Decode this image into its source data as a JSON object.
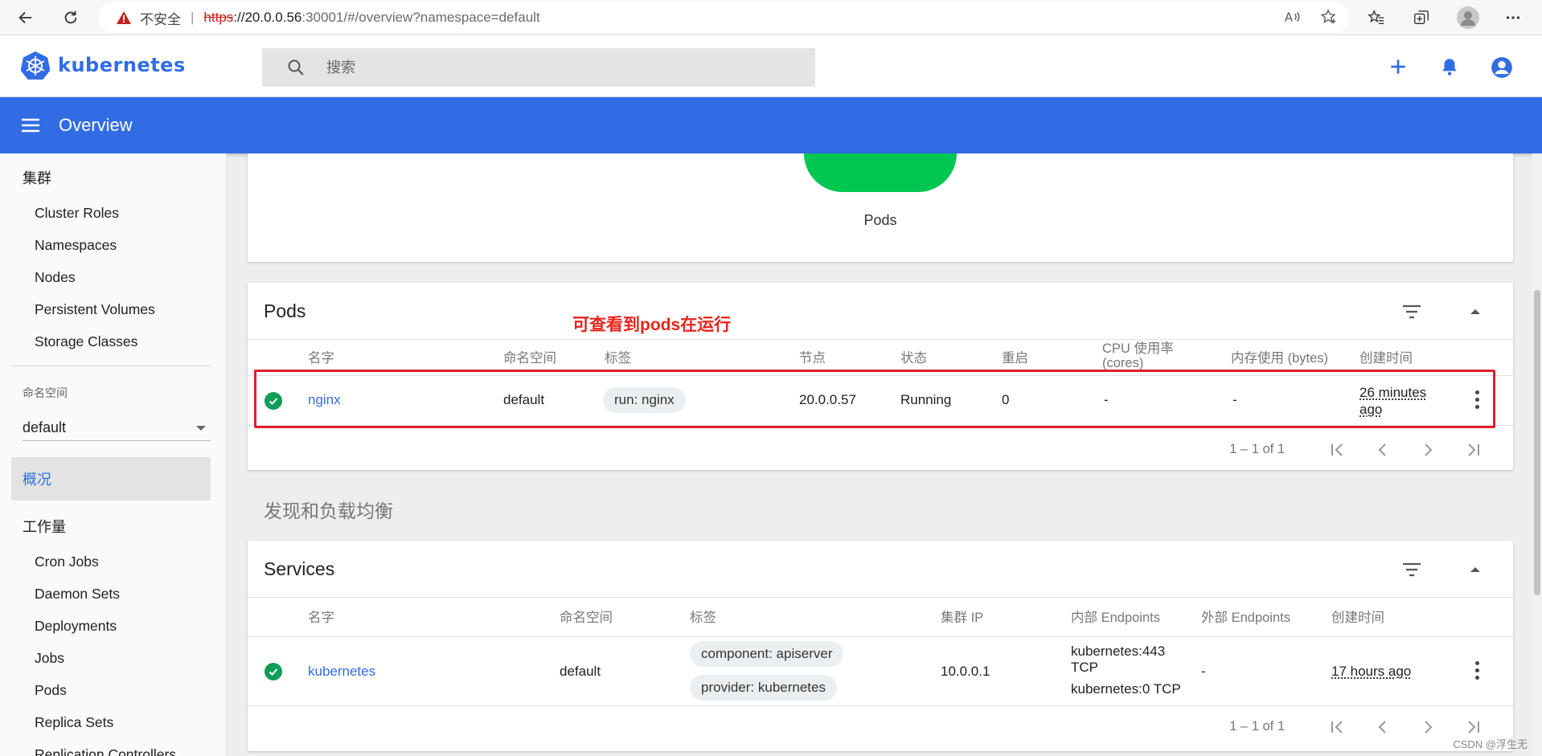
{
  "browser": {
    "insecure_label": "不安全",
    "url_scheme": "https",
    "url_host": "://20.0.0.56",
    "url_rest": ":30001/#/overview?namespace=default"
  },
  "app": {
    "logo_text": "kubernetes",
    "search_placeholder": "搜索",
    "toolbar_title": "Overview"
  },
  "sidebar": {
    "cluster_heading": "集群",
    "cluster_items": [
      "Cluster Roles",
      "Namespaces",
      "Nodes",
      "Persistent Volumes",
      "Storage Classes"
    ],
    "namespace_label": "命名空间",
    "namespace_value": "default",
    "overview_label": "概况",
    "workloads_heading": "工作量",
    "workload_items": [
      "Cron Jobs",
      "Daemon Sets",
      "Deployments",
      "Jobs",
      "Pods",
      "Replica Sets",
      "Replication Controllers"
    ]
  },
  "chart_card": {
    "label": "Pods"
  },
  "pods": {
    "title": "Pods",
    "annotation": "可查看到pods在运行",
    "columns": [
      "名字",
      "命名空间",
      "标签",
      "节点",
      "状态",
      "重启",
      "CPU 使用率 (cores)",
      "内存使用 (bytes)",
      "创建时间"
    ],
    "rows": [
      {
        "name": "nginx",
        "namespace": "default",
        "label": "run: nginx",
        "node": "20.0.0.57",
        "status": "Running",
        "restarts": "0",
        "cpu": "-",
        "memory": "-",
        "created": "26 minutes ago"
      }
    ],
    "pagination": "1 – 1 of 1"
  },
  "discovery_section": "发现和负载均衡",
  "services": {
    "title": "Services",
    "columns": [
      "名字",
      "命名空间",
      "标签",
      "集群 IP",
      "内部 Endpoints",
      "外部 Endpoints",
      "创建时间"
    ],
    "rows": [
      {
        "name": "kubernetes",
        "namespace": "default",
        "labels": [
          "component: apiserver",
          "provider: kubernetes"
        ],
        "cluster_ip": "10.0.0.1",
        "internal_endpoints": [
          "kubernetes:443 TCP",
          "kubernetes:0 TCP"
        ],
        "external_endpoints": "-",
        "created": "17 hours ago"
      }
    ],
    "pagination": "1 – 1 of 1"
  },
  "watermark": "CSDN @浮生无",
  "colors": {
    "brand": "#326ce5",
    "running": "#0f9d58",
    "pie": "#00c752",
    "annotation": "#e6251b"
  }
}
